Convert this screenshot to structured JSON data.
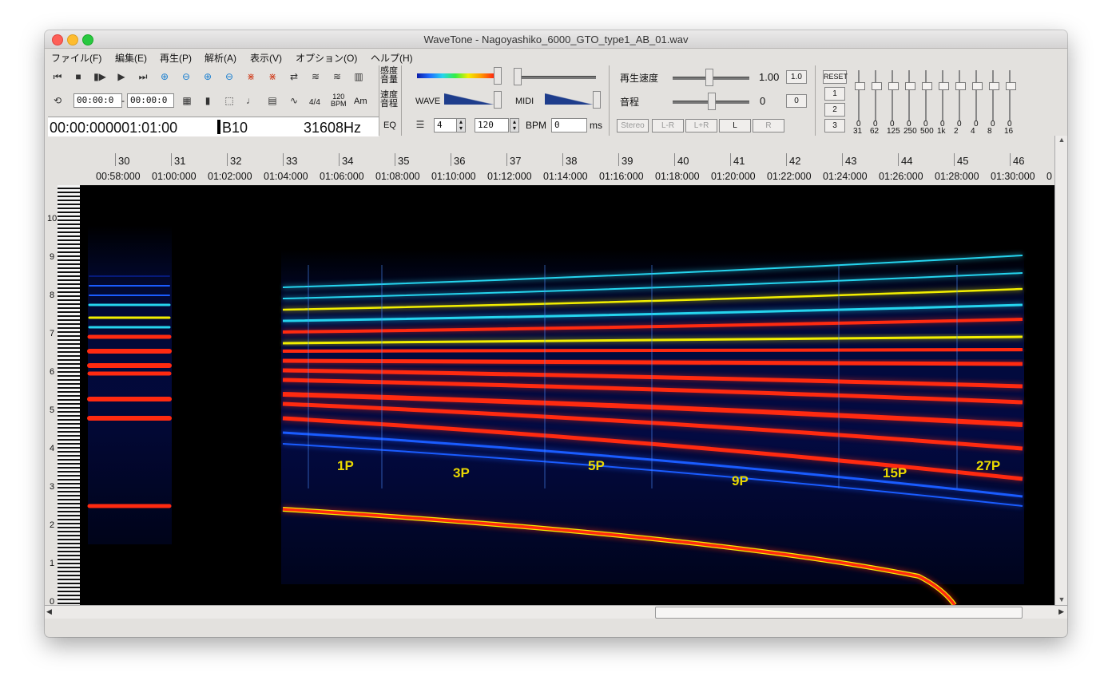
{
  "window": {
    "title": "WaveTone - Nagoyashiko_6000_GTO_type1_AB_01.wav"
  },
  "menu": [
    "ファイル(F)",
    "編集(E)",
    "再生(P)",
    "解析(A)",
    "表示(V)",
    "オプション(O)",
    "ヘルプ(H)"
  ],
  "toolbar": {
    "time_start": "00:00:0",
    "time_dash": "-",
    "time_end": "00:00:0",
    "time_sig": "4/4",
    "bpm_top": "120",
    "bpm_bottom": "BPM",
    "chord": "Am",
    "position": "00:00:000001:01:00",
    "note": "B10",
    "freq": "31608Hz"
  },
  "panel": {
    "sens_vol": "感度\n音量",
    "speed_pitch": "速度\n音程",
    "eq": "EQ",
    "wave": "WAVE",
    "midi": "MIDI",
    "beats": "4",
    "tempo": "120",
    "bpm_label": "BPM",
    "offset": "0",
    "ms": "ms"
  },
  "playback": {
    "speed_label": "再生速度",
    "speed_value": "1.00",
    "speed_reset": "1.0",
    "pitch_label": "音程",
    "pitch_value": "0",
    "pitch_reset": "0",
    "modes": [
      "Stereo",
      "L-R",
      "L+R",
      "L",
      "R"
    ]
  },
  "eq": {
    "reset": "RESET",
    "presets": [
      "1",
      "2",
      "3"
    ],
    "values": [
      "0",
      "0",
      "0",
      "0",
      "0",
      "0",
      "0",
      "0",
      "0",
      "0"
    ],
    "bands": [
      "31",
      "62",
      "125",
      "250",
      "500",
      "1k",
      "2",
      "4",
      "8",
      "16"
    ]
  },
  "ruler": {
    "bars": [
      "30",
      "31",
      "32",
      "33",
      "34",
      "35",
      "36",
      "37",
      "38",
      "39",
      "40",
      "41",
      "42",
      "43",
      "44",
      "45",
      "46"
    ],
    "times": [
      "00:58:000",
      "01:00:000",
      "01:02:000",
      "01:04:000",
      "01:06:000",
      "01:08:000",
      "01:10:000",
      "01:12:000",
      "01:14:000",
      "01:16:000",
      "01:18:000",
      "01:20:000",
      "01:22:000",
      "01:24:000",
      "01:26:000",
      "01:28:000",
      "01:30:000",
      "0"
    ]
  },
  "octaves": [
    "10",
    "9",
    "8",
    "7",
    "6",
    "5",
    "4",
    "3",
    "2",
    "1",
    "0"
  ],
  "annotations": [
    "1P",
    "3P",
    "5P",
    "9P",
    "15P",
    "27P"
  ],
  "colors": {
    "hot": "#ff2a10",
    "mid": "#f2ee00",
    "cool": "#25d4ee",
    "low": "#1a5cff",
    "deep": "#061a7a",
    "annot": "#e9d800"
  }
}
